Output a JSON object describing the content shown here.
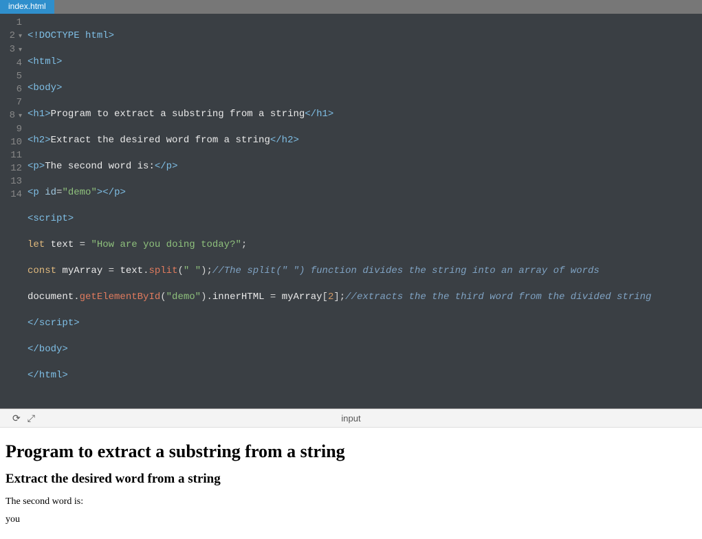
{
  "tab": {
    "name": "index.html"
  },
  "gutter": [
    "1",
    "2",
    "3",
    "4",
    "5",
    "6",
    "7",
    "8",
    "9",
    "10",
    "11",
    "12",
    "13",
    "14"
  ],
  "code": {
    "l1": "<!DOCTYPE html>",
    "l2": "<html>",
    "l3": "<body>",
    "l4_open": "<h1>",
    "l4_text": "Program to extract a substring from a string",
    "l4_close": "</h1>",
    "l5_open": "<h2>",
    "l5_text": "Extract the desired word from a string",
    "l5_close": "</h2>",
    "l6_open": "<p>",
    "l6_text": "The second word is:",
    "l6_close": "</p>",
    "l7_open": "<p ",
    "l7_attr": "id",
    "l7_eq": "=",
    "l7_val": "\"demo\"",
    "l7_close1": ">",
    "l7_close2": "</p>",
    "l8": "<script>",
    "l9_kw1": "let",
    "l9_s1": " text ",
    "l9_eq": "=",
    "l9_s2": " ",
    "l9_str": "\"How are you doing today?\"",
    "l9_semi": ";",
    "l10_kw1": "const",
    "l10_s1": " myArray ",
    "l10_eq": "=",
    "l10_s2": " text",
    "l10_dot": ".",
    "l10_fn": "split",
    "l10_p1": "(",
    "l10_arg": "\" \"",
    "l10_p2": ")",
    "l10_semi": ";",
    "l10_com": "//The split(\" \") function divides the string into an array of words",
    "l11_s1": "document",
    "l11_dot1": ".",
    "l11_fn": "getElementById",
    "l11_p1": "(",
    "l11_arg": "\"demo\"",
    "l11_p2": ")",
    "l11_dot2": ".",
    "l11_prop": "innerHTML ",
    "l11_eq": "=",
    "l11_s2": " myArray",
    "l11_b1": "[",
    "l11_idx": "2",
    "l11_b2": "]",
    "l11_semi": ";",
    "l11_com": "//extracts the the third word from the divided string",
    "l12_raw": "script>",
    "l13": "</body>",
    "l14": "</html>"
  },
  "divider": {
    "label": "input"
  },
  "preview": {
    "h1": "Program to extract a substring from a string",
    "h2": "Extract the desired word from a string",
    "p1": "The second word is:",
    "p2": "you"
  }
}
